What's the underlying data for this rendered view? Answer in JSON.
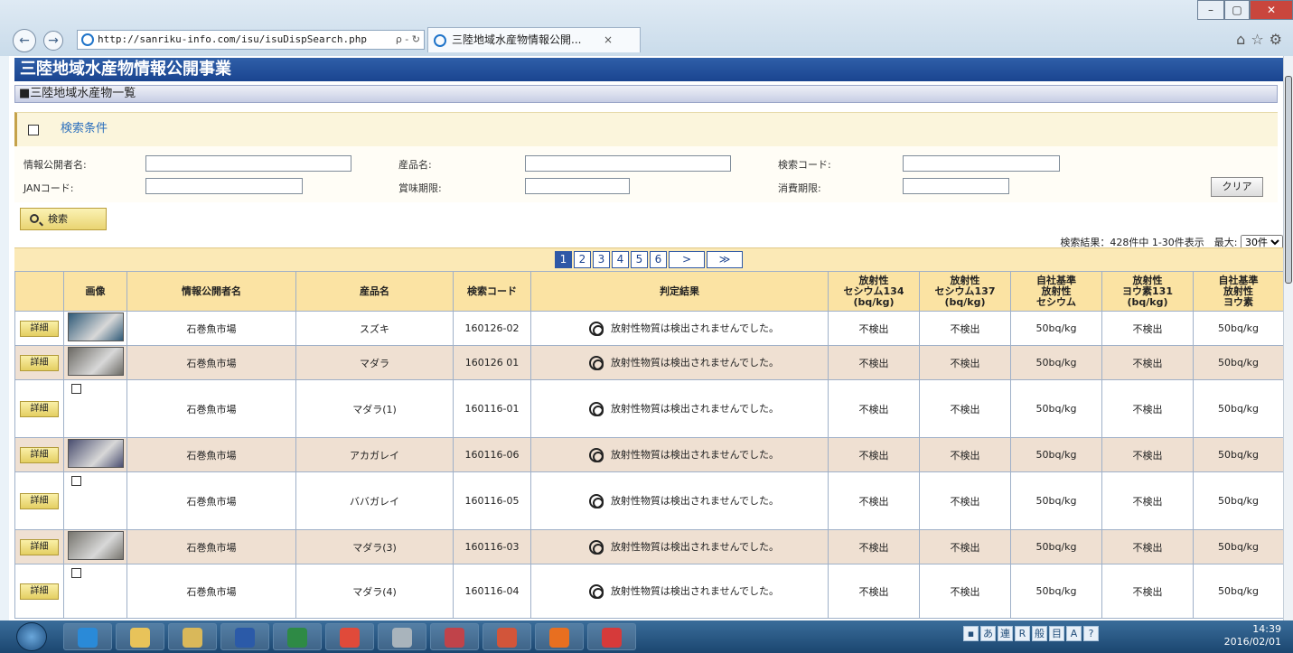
{
  "browser": {
    "url": "http://sanriku-info.com/isu/isuDispSearch.php",
    "url_tools": "ρ - ↻",
    "tab_title": "三陸地域水産物情報公開...",
    "tab_close": "×",
    "back_icon": "←",
    "forward_icon": "→",
    "minimize": "–",
    "restore": "▢",
    "close": "✕",
    "right_icons": "⌂☆⚙"
  },
  "site": {
    "title": "三陸地域水産物情報公開事業",
    "subtitle": "■三陸地域水産物一覧",
    "cond_label": "検索条件"
  },
  "form": {
    "publisher_label": "情報公開者名:",
    "product_label": "産品名:",
    "code_label": "検索コード:",
    "jan_label": "JANコード:",
    "bestby_label": "賞味期限:",
    "expiry_label": "消費期限:",
    "clear_label": "クリア",
    "search_label": "検索"
  },
  "results": {
    "info": "検索結果：428件中 1-30件表示　最大:",
    "max": "30件"
  },
  "pager": {
    "pages": [
      "1",
      "2",
      "3",
      "4",
      "5",
      "6"
    ],
    "next": ">",
    "last": "≫"
  },
  "table": {
    "headers": [
      "",
      "画像",
      "情報公開者名",
      "産品名",
      "検索コード",
      "判定結果",
      "放射性\nセシウム134\n(bq/kg)",
      "放射性\nセシウム137\n(bq/kg)",
      "自社基準\n放射性\nセシウム",
      "放射性\nヨウ素131\n(bq/kg)",
      "自社基準\n放射性\nヨウ素"
    ],
    "detail_label": "詳細",
    "rows": [
      {
        "publisher": "石巻魚市場",
        "product": "スズキ",
        "code": "160126-02",
        "result": "放射性物質は検出されませんでした。",
        "cs134": "不検出",
        "cs137": "不検出",
        "cs_std": "50bq/kg",
        "i131": "不検出",
        "i_std": "50bq/kg",
        "thumb": "#2f5a78"
      },
      {
        "publisher": "石巻魚市場",
        "product": "マダラ",
        "code": "160126 01",
        "result": "放射性物質は検出されませんでした。",
        "cs134": "不検出",
        "cs137": "不検出",
        "cs_std": "50bq/kg",
        "i131": "不検出",
        "i_std": "50bq/kg",
        "thumb": "#6c6a64"
      },
      {
        "publisher": "石巻魚市場",
        "product": "マダラ(1)",
        "code": "160116-01",
        "result": "放射性物質は検出されませんでした。",
        "cs134": "不検出",
        "cs137": "不検出",
        "cs_std": "50bq/kg",
        "i131": "不検出",
        "i_std": "50bq/kg",
        "thumb": ""
      },
      {
        "publisher": "石巻魚市場",
        "product": "アカガレイ",
        "code": "160116-06",
        "result": "放射性物質は検出されませんでした。",
        "cs134": "不検出",
        "cs137": "不検出",
        "cs_std": "50bq/kg",
        "i131": "不検出",
        "i_std": "50bq/kg",
        "thumb": "#4a4e70"
      },
      {
        "publisher": "石巻魚市場",
        "product": "ババガレイ",
        "code": "160116-05",
        "result": "放射性物質は検出されませんでした。",
        "cs134": "不検出",
        "cs137": "不検出",
        "cs_std": "50bq/kg",
        "i131": "不検出",
        "i_std": "50bq/kg",
        "thumb": ""
      },
      {
        "publisher": "石巻魚市場",
        "product": "マダラ(3)",
        "code": "160116-03",
        "result": "放射性物質は検出されませんでした。",
        "cs134": "不検出",
        "cs137": "不検出",
        "cs_std": "50bq/kg",
        "i131": "不検出",
        "i_std": "50bq/kg",
        "thumb": "#77756e"
      },
      {
        "publisher": "石巻魚市場",
        "product": "マダラ(4)",
        "code": "160116-04",
        "result": "放射性物質は検出されませんでした。",
        "cs134": "不検出",
        "cs137": "不検出",
        "cs_std": "50bq/kg",
        "i131": "不検出",
        "i_std": "50bq/kg",
        "thumb": ""
      }
    ]
  },
  "taskbar": {
    "apps": [
      {
        "name": "ie",
        "color": "#2a8ad8"
      },
      {
        "name": "explorer",
        "color": "#e8c35a"
      },
      {
        "name": "folder",
        "color": "#d9b85a"
      },
      {
        "name": "word",
        "color": "#2b5aa8"
      },
      {
        "name": "excel",
        "color": "#2e8a45"
      },
      {
        "name": "chrome",
        "color": "#e04a3a"
      },
      {
        "name": "network",
        "color": "#a9b4bc"
      },
      {
        "name": "picture",
        "color": "#c0434a"
      },
      {
        "name": "powerpoint",
        "color": "#d2553a"
      },
      {
        "name": "media",
        "color": "#e86f20"
      },
      {
        "name": "app",
        "color": "#d63a3a"
      }
    ],
    "tray": [
      "▪",
      "あ",
      "連",
      "R",
      "般",
      "目",
      "A",
      "?"
    ],
    "time": "14:39",
    "date": "2016/02/01"
  }
}
